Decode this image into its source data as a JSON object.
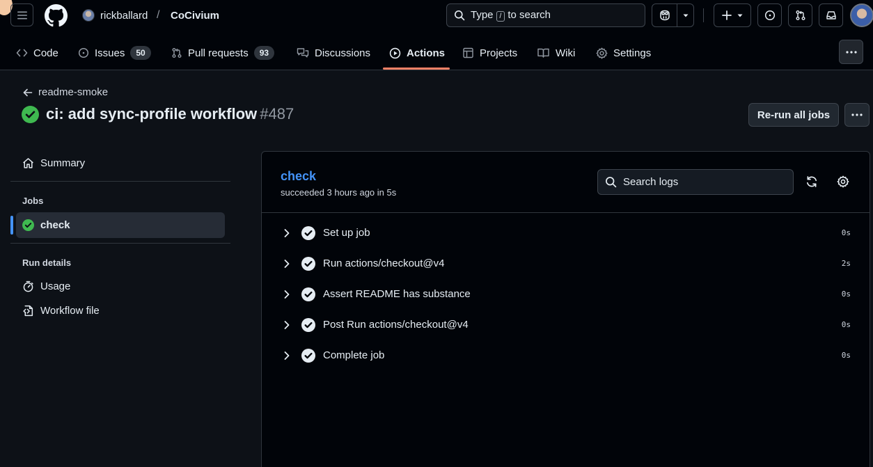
{
  "header": {
    "owner": "rickballard",
    "separator": "/",
    "repo": "CoCivium",
    "search": {
      "prefix": "Type",
      "key": "/",
      "suffix": "to search"
    }
  },
  "nav": {
    "tabs": [
      {
        "label": "Code"
      },
      {
        "label": "Issues",
        "count": "50"
      },
      {
        "label": "Pull requests",
        "count": "93"
      },
      {
        "label": "Discussions"
      },
      {
        "label": "Actions",
        "active": true
      },
      {
        "label": "Projects"
      },
      {
        "label": "Wiki"
      },
      {
        "label": "Settings"
      }
    ]
  },
  "run": {
    "back_label": "readme-smoke",
    "title": "ci: add sync-profile workflow",
    "number": "#487",
    "rerun_label": "Re-run all jobs"
  },
  "sidebar": {
    "summary_label": "Summary",
    "jobs_heading": "Jobs",
    "selected_job": "check",
    "run_details_heading": "Run details",
    "usage_label": "Usage",
    "workflow_file_label": "Workflow file"
  },
  "job": {
    "name": "check",
    "meta": "succeeded 3 hours ago in 5s",
    "search_placeholder": "Search logs",
    "steps": [
      {
        "name": "Set up job",
        "duration": "0s"
      },
      {
        "name": "Run actions/checkout@v4",
        "duration": "2s"
      },
      {
        "name": "Assert README has substance",
        "duration": "0s"
      },
      {
        "name": "Post Run actions/checkout@v4",
        "duration": "0s"
      },
      {
        "name": "Complete job",
        "duration": "0s"
      }
    ]
  },
  "colors": {
    "success": "#3fb950",
    "link": "#4493f8",
    "active_tab_underline": "#f78166"
  }
}
